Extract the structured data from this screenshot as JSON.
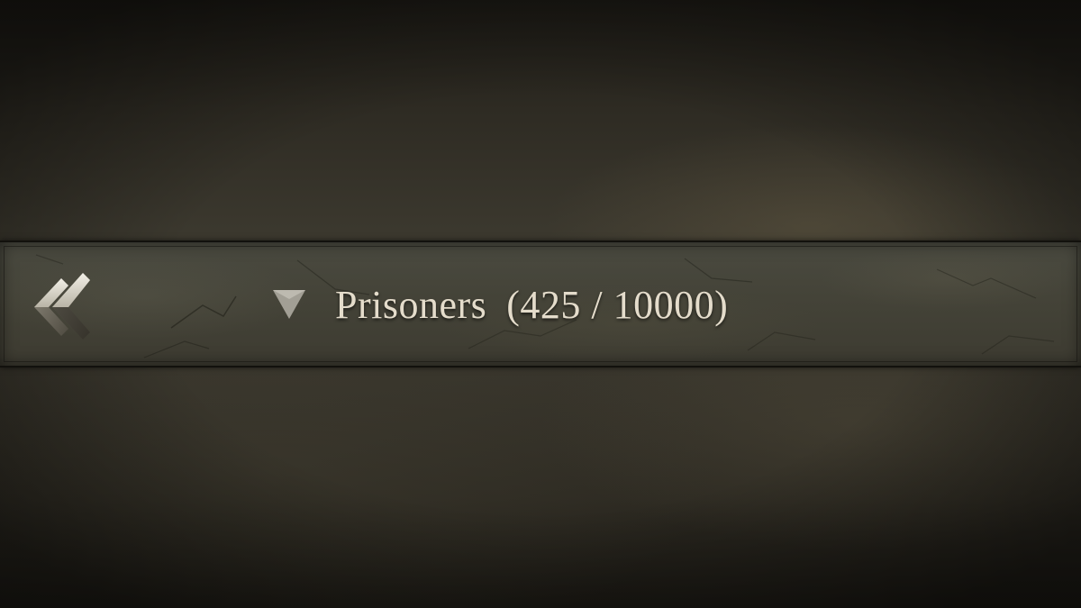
{
  "prisoners_section": {
    "title": "Prisoners",
    "count_text": "(425 / 10000)",
    "current_count": 425,
    "capacity": 10000,
    "collapse_icon": "triangle-down-icon",
    "back_icon": "double-chevron-left-icon"
  },
  "colors": {
    "text": "#e4dccb",
    "panel": "#444338",
    "background": "#37342b"
  }
}
